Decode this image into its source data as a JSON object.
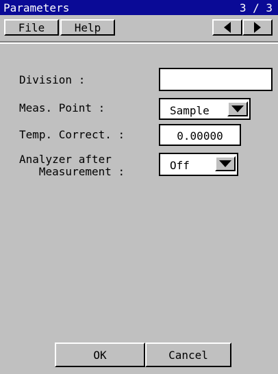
{
  "window": {
    "title": "Parameters",
    "page_indicator": "3 / 3"
  },
  "menu": {
    "file": "File",
    "help": "Help"
  },
  "fields": {
    "division": {
      "label": "Division :",
      "value": ""
    },
    "meas_point": {
      "label": "Meas. Point :",
      "value": "Sample"
    },
    "temp_correct": {
      "label": "Temp. Correct. :",
      "value": "0.00000"
    },
    "analyzer": {
      "label_line1": "Analyzer after",
      "label_line2": "   Measurement :",
      "value": "Off"
    }
  },
  "buttons": {
    "ok": "OK",
    "cancel": "Cancel"
  },
  "colors": {
    "titlebar": "#0a0a96",
    "background": "#c0c0c0"
  },
  "icons": {
    "prev": "left-arrow-icon",
    "next": "right-arrow-icon",
    "dropdown": "chevron-down-icon"
  }
}
